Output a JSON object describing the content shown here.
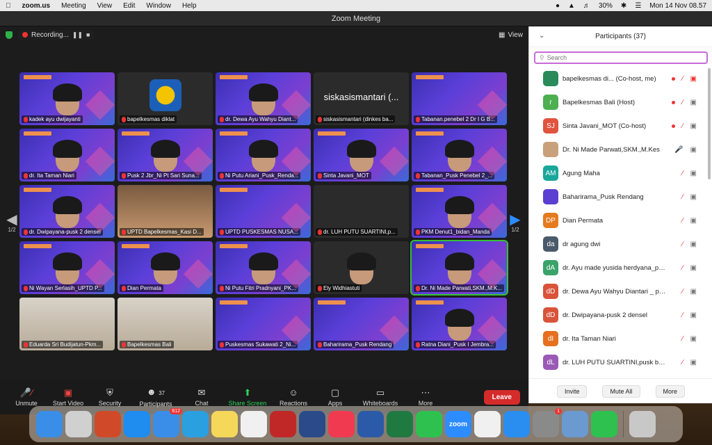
{
  "menubar": {
    "app_name": "zoom.us",
    "menus": [
      "Meeting",
      "View",
      "Edit",
      "Window",
      "Help"
    ],
    "battery": "30%",
    "datetime": "Mon 14 Nov  08.57"
  },
  "window": {
    "title": "Zoom Meeting",
    "recording_label": "Recording...",
    "view_label": "View"
  },
  "gallery": {
    "page_left": "1/2",
    "page_right": "1/2",
    "tiles": [
      {
        "name": "kadek ayu dwijayanti",
        "style": "slide-face"
      },
      {
        "name": "bapelkesmas diklat",
        "style": "logo"
      },
      {
        "name": "dr. Dewa Ayu Wahyu Diant...",
        "style": "slide-face"
      },
      {
        "name": "siskasismantari (dinkes ba...",
        "style": "text",
        "big": "siskasismantari (..."
      },
      {
        "name": "Tabanan.penebel 2 Dr I G B...",
        "style": "slide"
      },
      {
        "name": "dr. Ita Taman Niari",
        "style": "slide-face"
      },
      {
        "name": "Pusk 2 Jbr_Ni Pt Sari Suna...",
        "style": "slide-face"
      },
      {
        "name": "Ni Putu Ariani_Pusk_Renda...",
        "style": "slide-face"
      },
      {
        "name": "Sinta Javani_MOT",
        "style": "slide-face"
      },
      {
        "name": "Tabanan_Pusk Penebel 2_...",
        "style": "slide-face"
      },
      {
        "name": "dr. Dwipayana-pusk 2 densel",
        "style": "slide-face"
      },
      {
        "name": "UPTD Bapelkesmas_Kasi D...",
        "style": "photo2"
      },
      {
        "name": "UPTD PUSKESMAS NUSA...",
        "style": "slide"
      },
      {
        "name": "dr. LUH PUTU SUARTINI,p...",
        "style": "dark"
      },
      {
        "name": "PKM Denut1_bidan_Manda",
        "style": "slide-face"
      },
      {
        "name": "Ni Wayan Serlasih_UPTD P...",
        "style": "slide-face"
      },
      {
        "name": "Dian Permata",
        "style": "slide-face"
      },
      {
        "name": "Ni Putu Fitri Pradnyani_PK...",
        "style": "slide-face"
      },
      {
        "name": "Ely Widhiastuti",
        "style": "dark-face"
      },
      {
        "name": "Dr. Ni Made Parwati,SKM.,M.K...",
        "style": "slide-face-active"
      },
      {
        "name": "Eduarda Sri Budijatun-Pkm...",
        "style": "photo"
      },
      {
        "name": "Bapelkesmas Bali",
        "style": "photo"
      },
      {
        "name": "Puskesmas Sukawati 2_Ni...",
        "style": "slide"
      },
      {
        "name": "Baharirama_Pusk Rendang",
        "style": "slide"
      },
      {
        "name": "Ratna Diani_Pusk I Jembra...",
        "style": "slide-face"
      }
    ]
  },
  "controls": {
    "unmute": "Unmute",
    "start_video": "Start Video",
    "security": "Security",
    "participants": "Participants",
    "participants_count": "37",
    "chat": "Chat",
    "share_screen": "Share Screen",
    "reactions": "Reactions",
    "apps": "Apps",
    "whiteboards": "Whiteboards",
    "more": "More",
    "leave": "Leave"
  },
  "panel": {
    "title": "Participants (37)",
    "search_placeholder": "Search",
    "participants": [
      {
        "initials": "",
        "name": "bapelkesmas di...  (Co-host, me)",
        "color": "#2a8a5a",
        "rec": true,
        "cam_red": true
      },
      {
        "initials": "r",
        "name": "Bapelkesmas Bali (Host)",
        "color": "#4caf50",
        "rec": true,
        "cam_red": false
      },
      {
        "initials": "SJ",
        "name": "Sinta Javani_MOT (Co-host)",
        "color": "#e0533f",
        "rec": true,
        "cam_red": false
      },
      {
        "initials": "",
        "name": "Dr. Ni Made Parwati,SKM.,M.Kes",
        "color": "#c8a07a",
        "rec": false,
        "cam_red": false
      },
      {
        "initials": "AM",
        "name": "Agung Maha",
        "color": "#19a79a",
        "rec": false,
        "cam_red": false
      },
      {
        "initials": "",
        "name": "Baharirama_Pusk Rendang",
        "color": "#5b3fd0",
        "rec": false,
        "cam_red": false
      },
      {
        "initials": "DP",
        "name": "Dian Permata",
        "color": "#e57a1f",
        "rec": false,
        "cam_red": false
      },
      {
        "initials": "da",
        "name": "dr agung dwi",
        "color": "#4a5a6a",
        "rec": false,
        "cam_red": false
      },
      {
        "initials": "dA",
        "name": "dr. Ayu made yusida herdyana_pu...",
        "color": "#3aa36a",
        "rec": false,
        "cam_red": false
      },
      {
        "initials": "dD",
        "name": "dr. Dewa Ayu Wahyu Diantari _ pus...",
        "color": "#d9533a",
        "rec": false,
        "cam_red": false
      },
      {
        "initials": "dD",
        "name": "dr. Dwipayana-pusk 2 densel",
        "color": "#d9533a",
        "rec": false,
        "cam_red": false
      },
      {
        "initials": "dI",
        "name": "dr. Ita Taman Niari",
        "color": "#e5701f",
        "rec": false,
        "cam_red": false
      },
      {
        "initials": "dL",
        "name": "dr. LUH PUTU SUARTINI,pusk banj...",
        "color": "#9b59b6",
        "rec": false,
        "cam_red": false
      }
    ],
    "invite": "Invite",
    "mute_all": "Mute All",
    "more": "More"
  },
  "dock": {
    "mail_badge": "612",
    "sys_badge": "1",
    "apps": [
      "Finder",
      "Launchpad",
      "PowerPoint",
      "App Store",
      "Mail",
      "Telegram",
      "Notes",
      "Photos",
      "Mendeley",
      "QuickTime",
      "Music",
      "Word",
      "Excel",
      "WhatsApp",
      "zoom",
      "Chrome",
      "Safari",
      "System Preferences",
      "Preview",
      "FaceTime",
      "Trash"
    ]
  }
}
